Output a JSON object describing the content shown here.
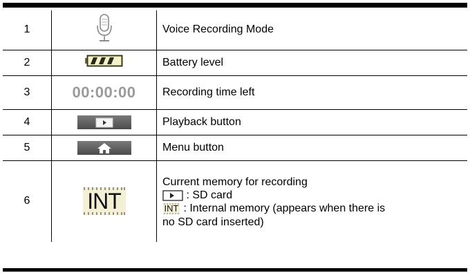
{
  "rows": [
    {
      "num": "1",
      "icon": "microphone-icon",
      "desc": "Voice Recording Mode"
    },
    {
      "num": "2",
      "icon": "battery-icon",
      "desc": "Battery level"
    },
    {
      "num": "3",
      "icon_text": "00:00:00",
      "desc": "Recording time left"
    },
    {
      "num": "4",
      "icon": "play-icon",
      "desc": "Playback button"
    },
    {
      "num": "5",
      "icon": "home-icon",
      "desc": "Menu button"
    },
    {
      "num": "6",
      "icon_text": "INT",
      "desc_lines": {
        "line1": "Current memory for recording",
        "sd": ": SD card",
        "int": ": Internal memory (appears when there is",
        "int_cont": "no SD card inserted)",
        "int_small": "INT"
      }
    }
  ],
  "colors": {
    "rule": "#000000",
    "time_text": "#9a9a9a",
    "button": "#5a5a5a",
    "battery": "#b8a84a"
  }
}
